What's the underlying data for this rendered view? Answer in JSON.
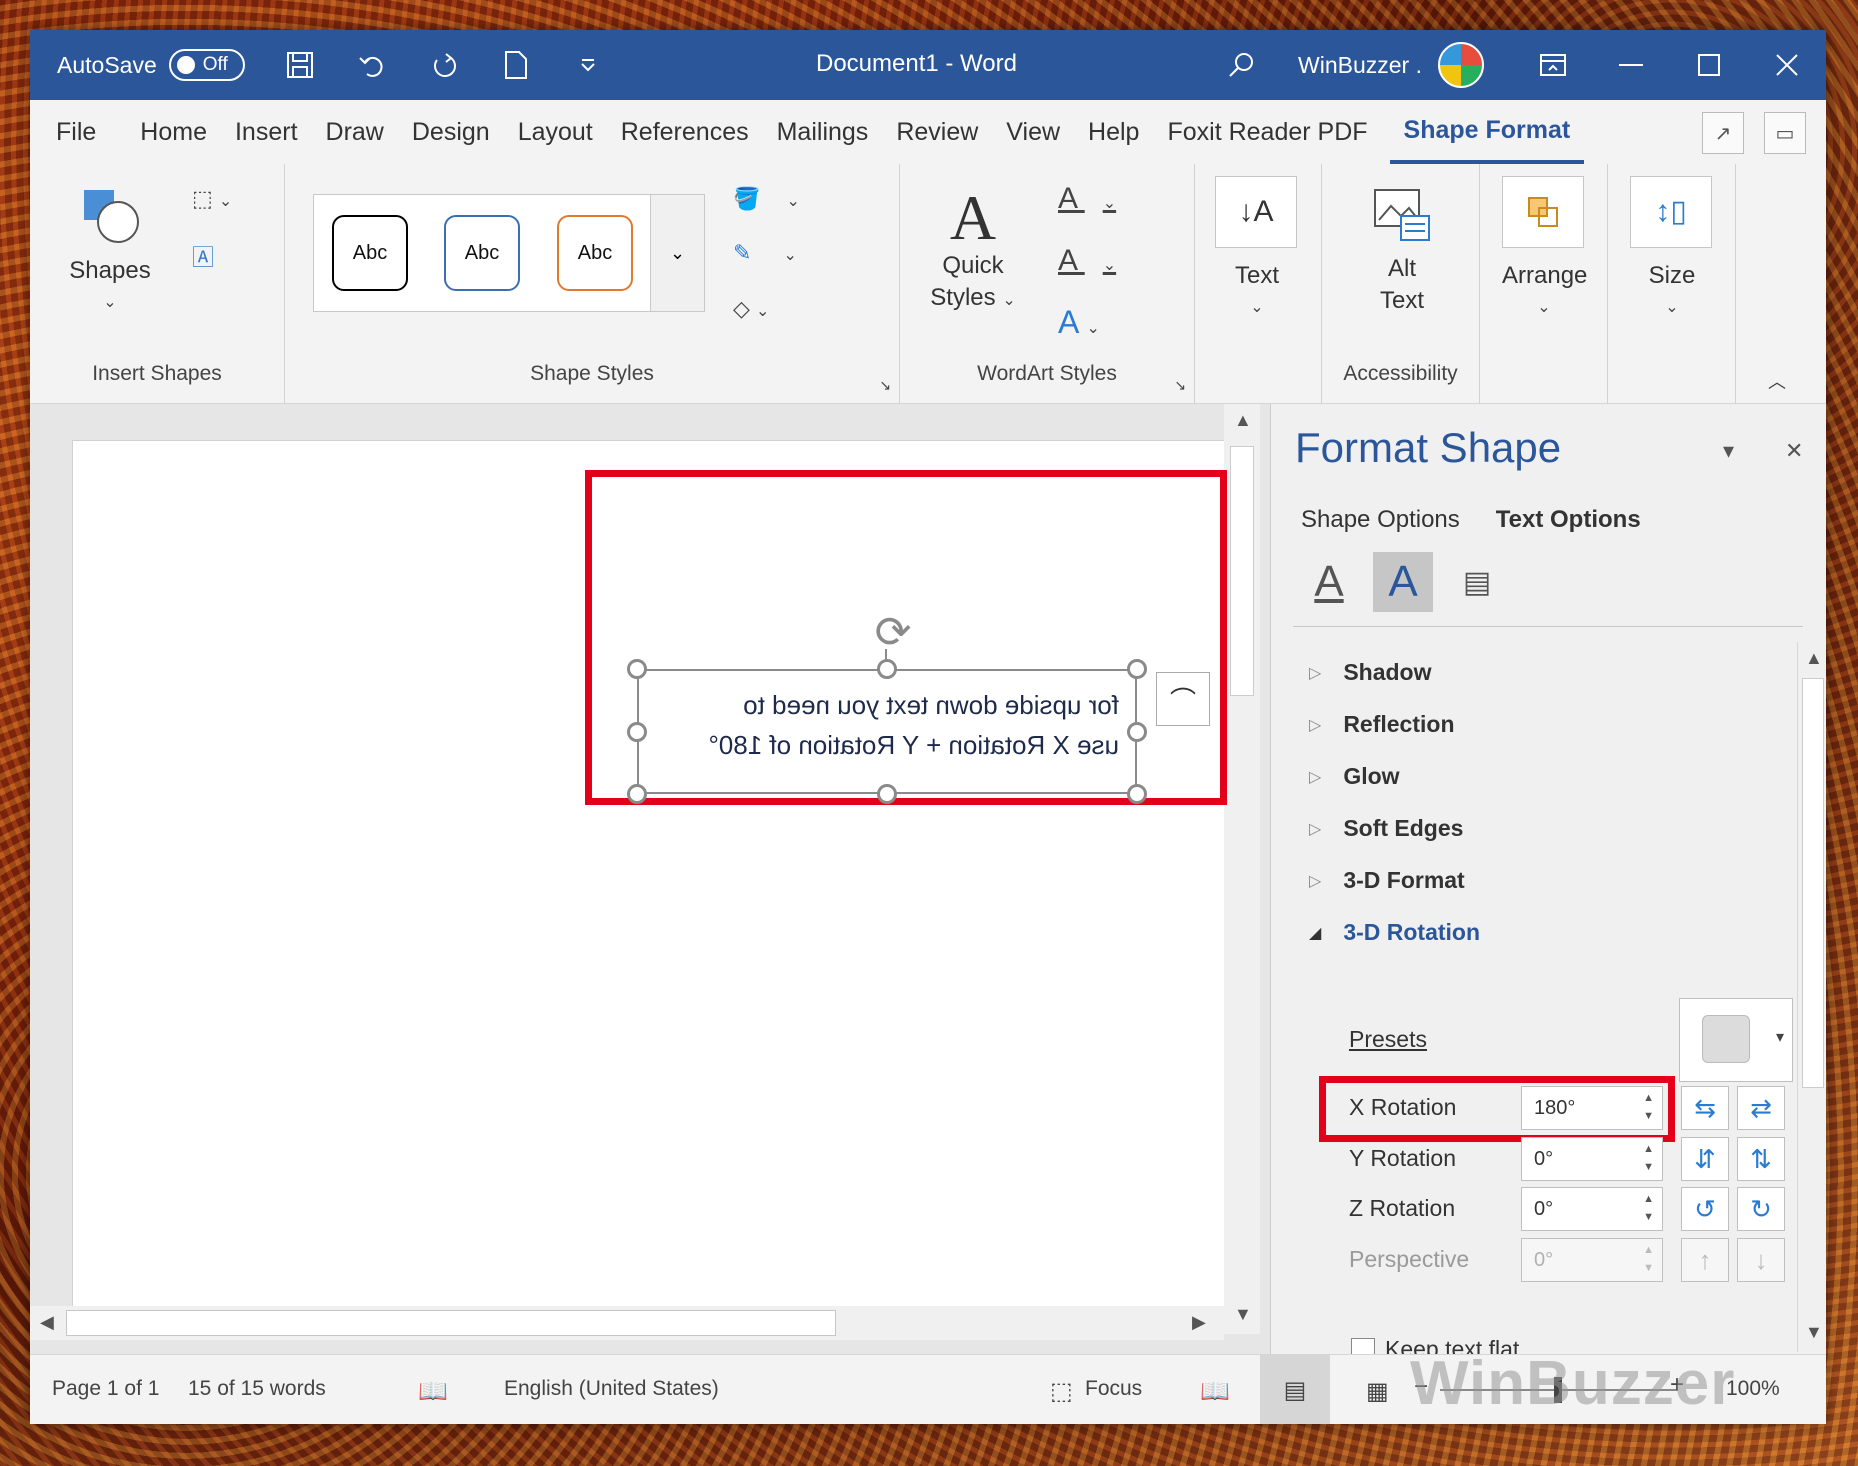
{
  "titlebar": {
    "autosave_label": "AutoSave",
    "autosave_state": "Off",
    "title": "Document1  -  Word",
    "user": "WinBuzzer .",
    "accent": "#2b579a"
  },
  "tabs": [
    "File",
    "Home",
    "Insert",
    "Draw",
    "Design",
    "Layout",
    "References",
    "Mailings",
    "Review",
    "View",
    "Help",
    "Foxit Reader PDF",
    "Shape Format"
  ],
  "active_tab": "Shape Format",
  "ribbon": {
    "insert_shapes": {
      "shapes_label": "Shapes",
      "group_label": "Insert Shapes"
    },
    "shape_styles": {
      "samples": [
        "Abc",
        "Abc",
        "Abc"
      ],
      "group_label": "Shape Styles"
    },
    "wordart": {
      "quick_styles_line1": "Quick",
      "quick_styles_line2": "Styles",
      "group_label": "WordArt Styles"
    },
    "text": {
      "label": "Text"
    },
    "accessibility": {
      "alt_line1": "Alt",
      "alt_line2": "Text",
      "group_label": "Accessibility"
    },
    "arrange": {
      "label": "Arrange"
    },
    "size": {
      "label": "Size"
    }
  },
  "document": {
    "shape_text_line1": "for upside down text you need to",
    "shape_text_line2": "use X Rotation + Y Rotation of 180°"
  },
  "pane": {
    "title": "Format Shape",
    "tab_shape": "Shape Options",
    "tab_text": "Text Options",
    "sections": [
      "Shadow",
      "Reflection",
      "Glow",
      "Soft Edges",
      "3-D Format",
      "3-D Rotation"
    ],
    "presets_label": "Presets",
    "x_rotation_label": "X Rotation",
    "x_rotation_value": "180°",
    "y_rotation_label": "Y Rotation",
    "y_rotation_value": "0°",
    "z_rotation_label": "Z Rotation",
    "z_rotation_value": "0°",
    "perspective_label": "Perspective",
    "perspective_value": "0°",
    "keep_flat_label": "Keep text flat"
  },
  "status": {
    "page": "Page 1 of 1",
    "words": "15 of 15 words",
    "language": "English (United States)",
    "focus": "Focus",
    "zoom": "100%"
  },
  "watermark": "WinBuzzer"
}
